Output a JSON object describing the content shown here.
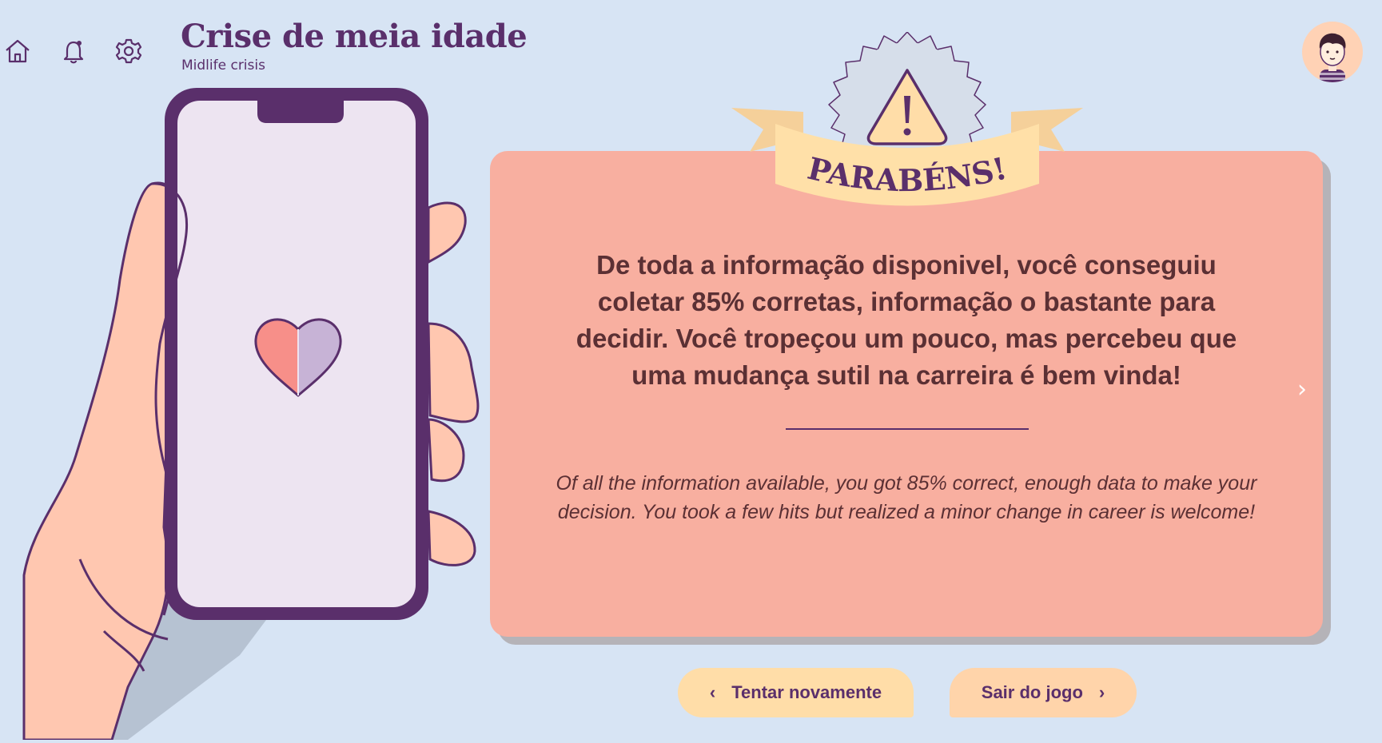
{
  "header": {
    "title": "Crise de meia idade",
    "subtitle": "Midlife crisis",
    "icons": [
      "home-icon",
      "bell-icon",
      "gear-icon"
    ]
  },
  "badge": {
    "label": "PARABÉNS!",
    "icon": "warning-icon"
  },
  "card": {
    "main_text": "De toda a informação disponivel, você conseguiu coletar 85% corretas, informação o bastante para decidir. Você tropeçou um pouco, mas percebeu que uma mudança sutil na carreira é bem vinda!",
    "sub_text": "Of all the information available, you got 85% correct, enough data to make your decision. You took a few hits but realized a minor change in career is welcome!",
    "next_arrow": "›"
  },
  "buttons": {
    "retry_label": "Tentar novamente",
    "retry_chevron": "‹",
    "exit_label": "Sair do jogo",
    "exit_chevron": "›"
  },
  "colors": {
    "background": "#d7e4f4",
    "card": "#f8afa0",
    "accent_purple": "#5a2f6b",
    "button": "#ffdda8",
    "ribbon": "#ffe0a8"
  }
}
